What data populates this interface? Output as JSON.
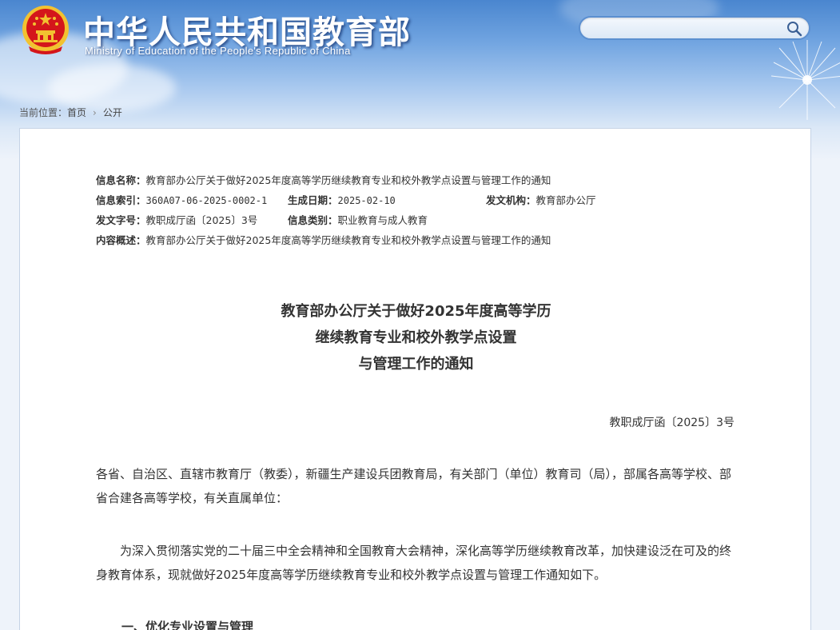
{
  "header": {
    "title": "中华人民共和国教育部",
    "subtitle": "Ministry of Education of the People's Republic of China",
    "search_placeholder": ""
  },
  "breadcrumb": {
    "prefix": "当前位置：",
    "items": [
      "首页",
      "公开"
    ]
  },
  "meta": {
    "name_label": "信息名称：",
    "name_value": "教育部办公厅关于做好2025年度高等学历继续教育专业和校外教学点设置与管理工作的通知",
    "index_label": "信息索引：",
    "index_value": "360A07-06-2025-0002-1",
    "date_label": "生成日期：",
    "date_value": "2025-02-10",
    "org_label": "发文机构：",
    "org_value": "教育部办公厅",
    "docno_label": "发文字号：",
    "docno_value": "教职成厅函〔2025〕3号",
    "category_label": "信息类别：",
    "category_value": "职业教育与成人教育",
    "summary_label": "内容概述：",
    "summary_value": "教育部办公厅关于做好2025年度高等学历继续教育专业和校外教学点设置与管理工作的通知"
  },
  "document": {
    "title_line1": "教育部办公厅关于做好2025年度高等学历",
    "title_line2": "继续教育专业和校外教学点设置",
    "title_line3": "与管理工作的通知",
    "number": "教职成厅函〔2025〕3号",
    "recipients": "各省、自治区、直辖市教育厅（教委），新疆生产建设兵团教育局，有关部门（单位）教育司（局），部属各高等学校、部省合建各高等学校，有关直属单位：",
    "intro": "为深入贯彻落实党的二十届三中全会精神和全国教育大会精神，深化高等学历继续教育改革，加快建设泛在可及的终身教育体系，现就做好2025年度高等学历继续教育专业和校外教学点设置与管理工作通知如下。",
    "section1": "一、优化专业设置与管理"
  },
  "colors": {
    "header_blue": "#4a86cf",
    "emblem_red": "#d4161b",
    "emblem_gold": "#f2c230"
  }
}
